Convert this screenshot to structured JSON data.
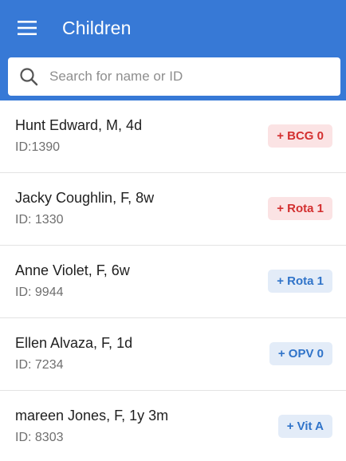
{
  "header": {
    "title": "Children",
    "menu_icon": "hamburger-menu-icon",
    "background_color": "#3779d6"
  },
  "search": {
    "placeholder": "Search for name or ID",
    "value": "",
    "icon": "search-icon"
  },
  "children": [
    {
      "name": "Hunt Edward, M, 4d",
      "id": "ID:1390",
      "badge": "+ BCG 0",
      "badge_status": "due",
      "badge_color": "#d32f2f"
    },
    {
      "name": "Jacky Coughlin, F, 8w",
      "id": "ID: 1330",
      "badge": "+ Rota 1",
      "badge_status": "due",
      "badge_color": "#d32f2f"
    },
    {
      "name": "Anne Violet, F, 6w",
      "id": "ID: 9944",
      "badge": "+ Rota 1",
      "badge_status": "upcoming",
      "badge_color": "#2f73c9"
    },
    {
      "name": "Ellen Alvaza, F, 1d",
      "id": "ID: 7234",
      "badge": "+ OPV 0",
      "badge_status": "upcoming",
      "badge_color": "#2f73c9"
    },
    {
      "name": "mareen Jones, F, 1y 3m",
      "id": "ID: 8303",
      "badge": "+ Vit A",
      "badge_status": "upcoming",
      "badge_color": "#2f73c9"
    }
  ]
}
